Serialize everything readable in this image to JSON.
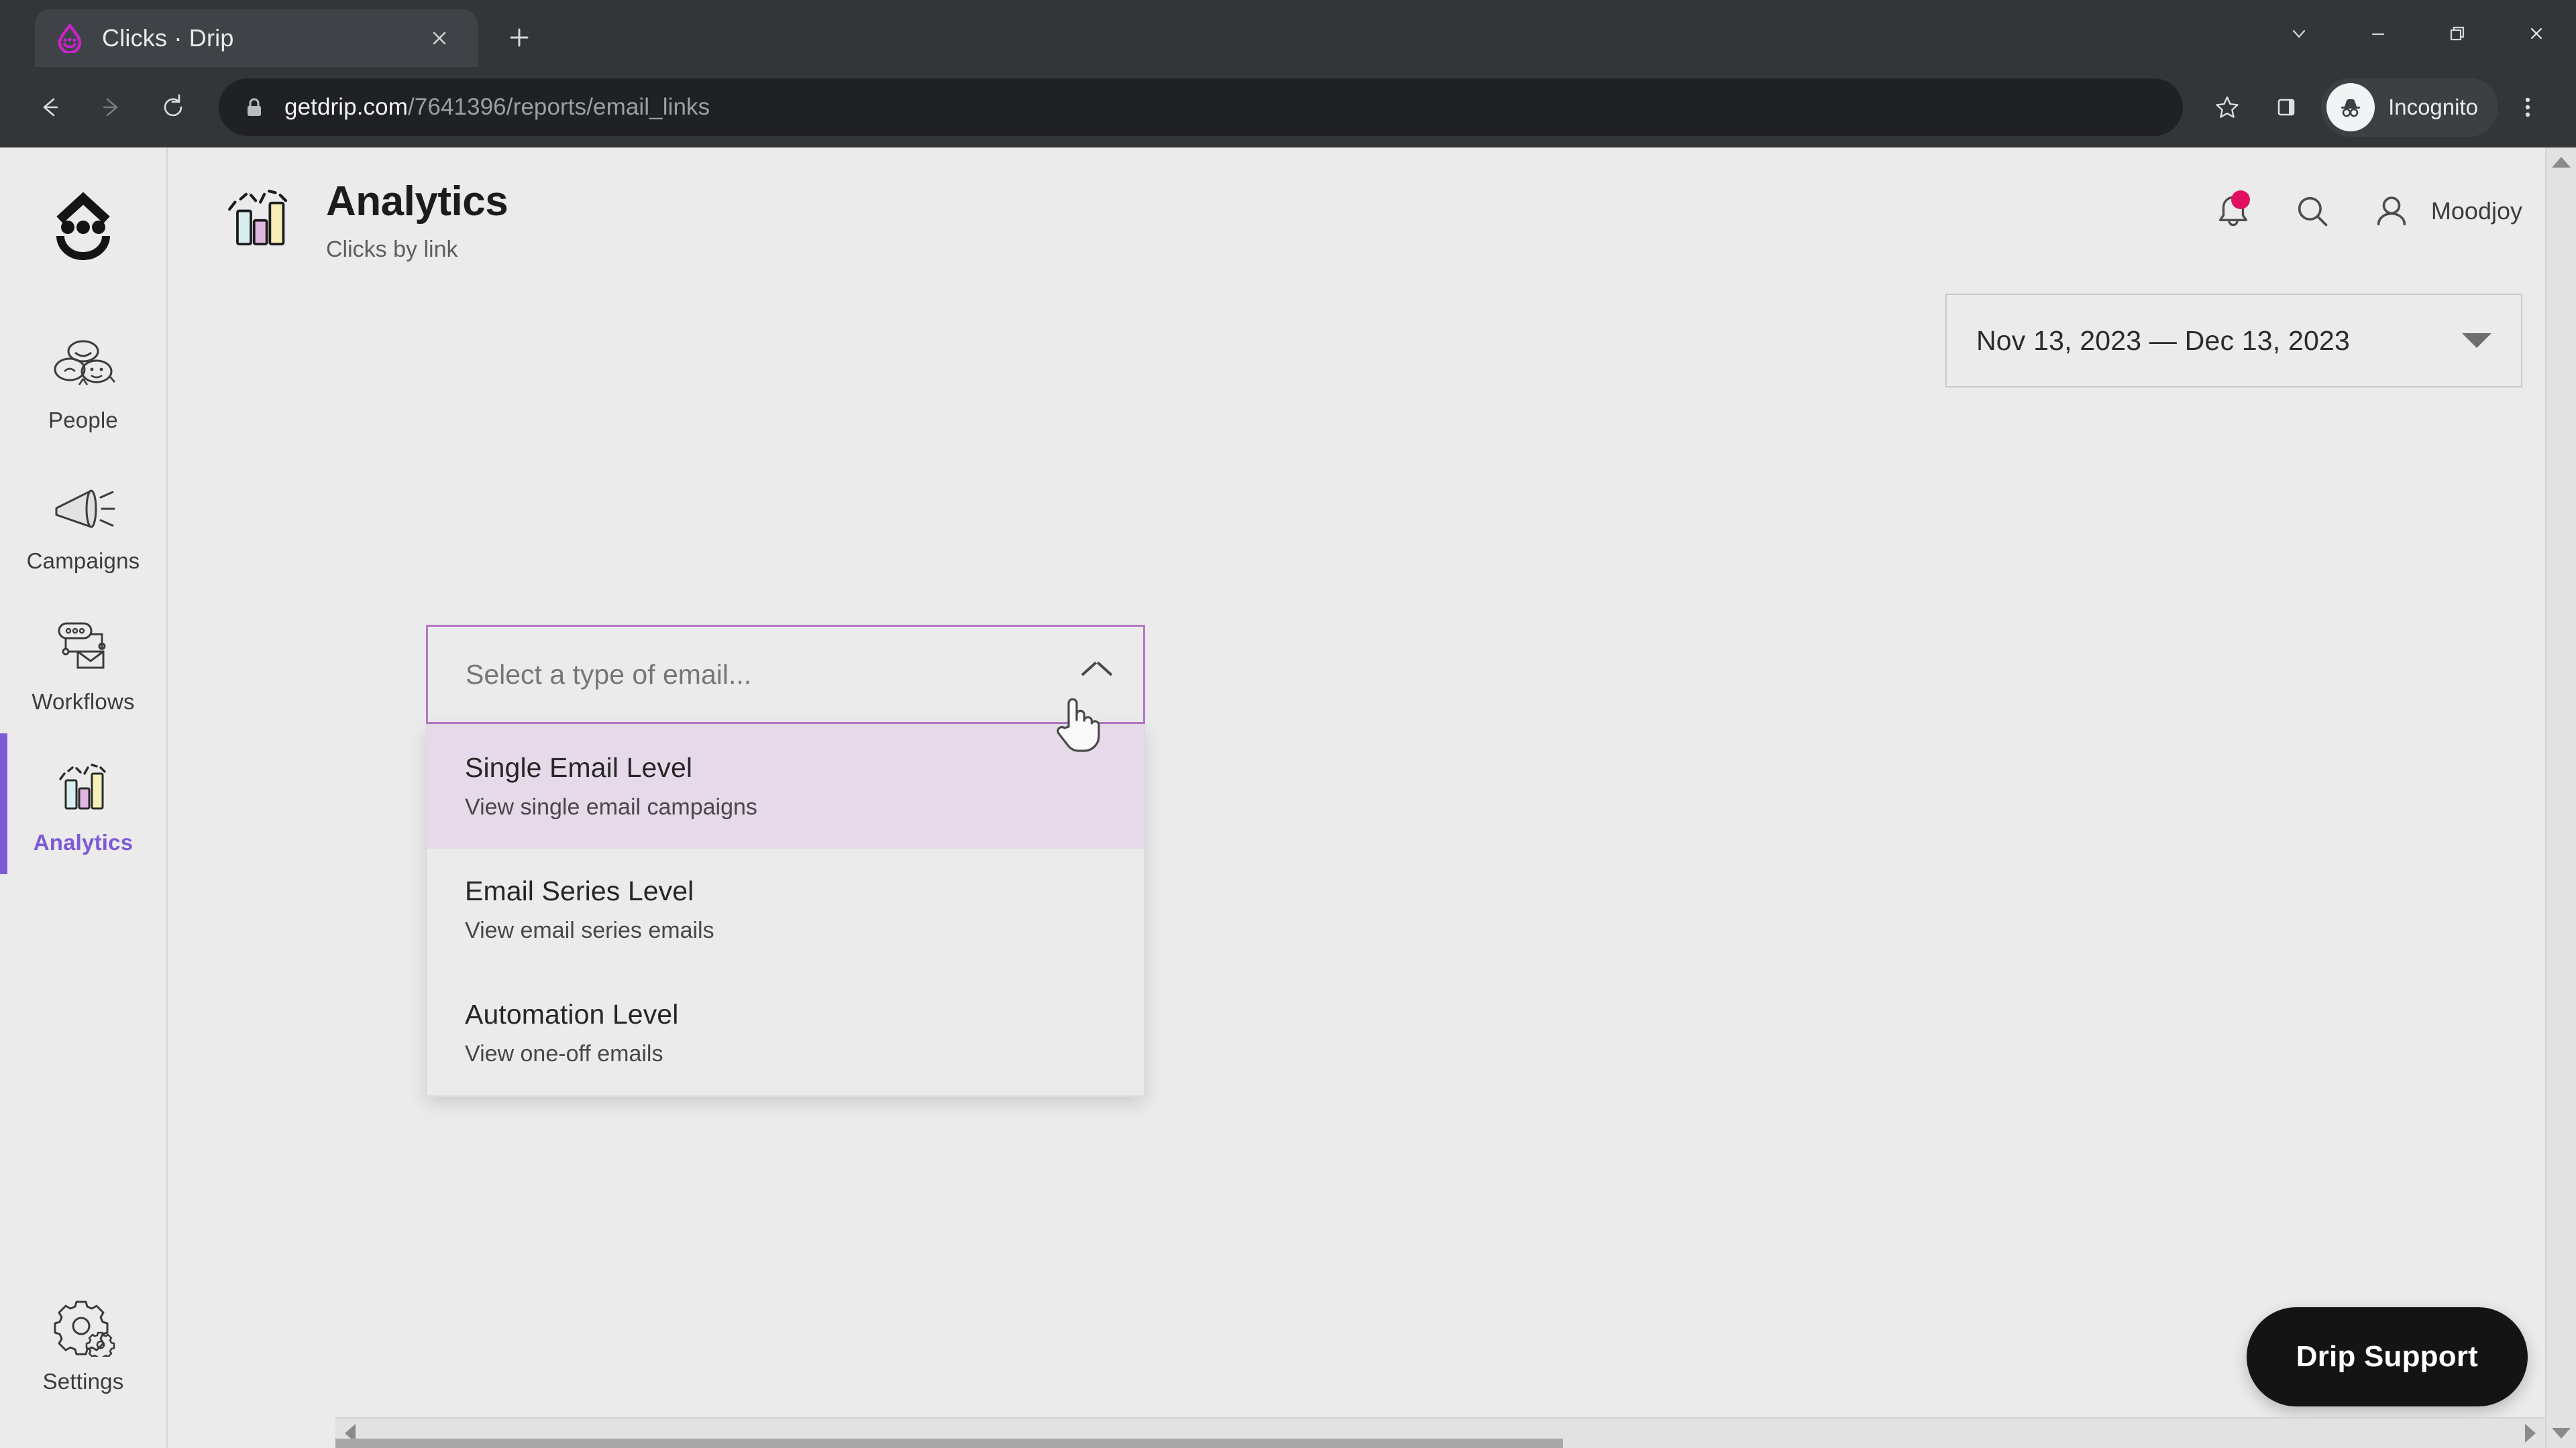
{
  "browser": {
    "tab": {
      "title": "Clicks · Drip",
      "favicon_icon": "drip-droplet-icon",
      "close_icon": "close-icon"
    },
    "new_tab_icon": "plus-icon",
    "window_controls": [
      {
        "name": "search-tabs-button",
        "icon": "chevron-down-icon"
      },
      {
        "name": "minimize-button",
        "icon": "minimize-icon"
      },
      {
        "name": "maximize-button",
        "icon": "restore-icon"
      },
      {
        "name": "close-window-button",
        "icon": "close-icon"
      }
    ],
    "nav": {
      "back_icon": "arrow-left-icon",
      "forward_icon": "arrow-right-icon",
      "reload_icon": "reload-icon"
    },
    "omnibox": {
      "lock_icon": "lock-icon",
      "url_domain": "getdrip.com",
      "url_path": "/7641396/reports/email_links"
    },
    "toolbar_right": {
      "bookmark_icon": "star-icon",
      "sidepanel_icon": "side-panel-icon",
      "incognito_label": "Incognito",
      "incognito_icon": "incognito-hat-icon",
      "menu_icon": "three-dots-vertical-icon"
    }
  },
  "sidebar": {
    "brand_icon": "drip-smiley-logo",
    "items": [
      {
        "label": "People",
        "icon": "people-icon",
        "active": false
      },
      {
        "label": "Campaigns",
        "icon": "megaphone-icon",
        "active": false
      },
      {
        "label": "Workflows",
        "icon": "workflow-icon",
        "active": false
      },
      {
        "label": "Analytics",
        "icon": "bar-chart-icon",
        "active": true
      }
    ],
    "bottom_item": {
      "label": "Settings",
      "icon": "gear-icon"
    }
  },
  "header": {
    "icon": "bar-chart-icon",
    "title": "Analytics",
    "subtitle": "Clicks by link",
    "notifications_icon": "bell-icon",
    "search_icon": "search-icon",
    "account_icon": "person-icon",
    "account_name": "Moodjoy"
  },
  "filters": {
    "date_range": "Nov 13, 2023 — Dec 13, 2023",
    "date_range_caret_icon": "caret-down-icon"
  },
  "email_type_select": {
    "placeholder": "Select a type of email...",
    "value": "",
    "expanded": true,
    "chevron_icon": "chevron-up-icon",
    "options": [
      {
        "title": "Single Email Level",
        "description": "View single email campaigns",
        "highlighted": true
      },
      {
        "title": "Email Series Level",
        "description": "View email series emails",
        "highlighted": false
      },
      {
        "title": "Automation Level",
        "description": "View one-off emails",
        "highlighted": false
      }
    ]
  },
  "support": {
    "label": "Drip Support"
  },
  "scrollbars": {
    "vertical_up_icon": "arrow-up-icon",
    "vertical_down_icon": "arrow-down-icon",
    "horizontal_left_icon": "arrow-left-icon",
    "horizontal_right_icon": "arrow-right-icon"
  },
  "colors": {
    "accent_purple": "#7d5bd4",
    "select_border": "#b478c6",
    "option_highlight": "#e6d9ea",
    "notification_dot": "#e0115f",
    "page_bg": "#ebebeb",
    "chrome_bg": "#323639"
  },
  "cursor": {
    "type": "pointer-hand"
  }
}
